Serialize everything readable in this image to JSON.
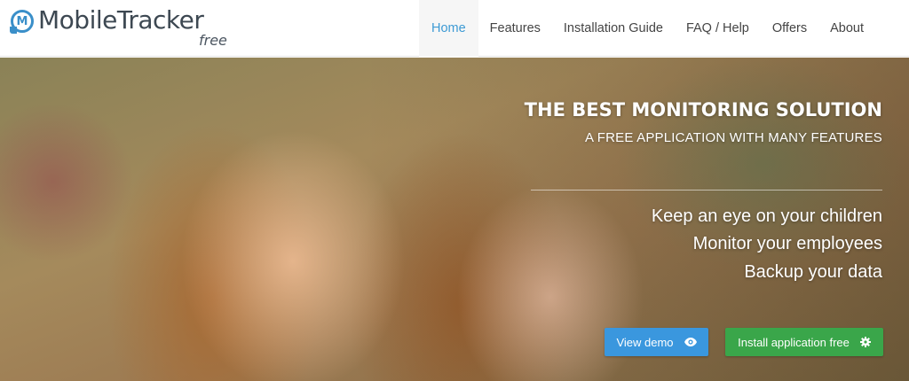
{
  "brand": {
    "name": "MobileTracker",
    "tagline": "free",
    "badge_letter": "M",
    "color": "#3a8fc9"
  },
  "nav": {
    "items": [
      {
        "label": "Home",
        "active": true
      },
      {
        "label": "Features"
      },
      {
        "label": "Installation Guide"
      },
      {
        "label": "FAQ / Help"
      },
      {
        "label": "Offers"
      },
      {
        "label": "About"
      }
    ],
    "active_color": "#3d9ad4"
  },
  "hero": {
    "title": "THE BEST MONITORING SOLUTION",
    "subtitle": "A FREE APPLICATION WITH MANY FEATURES",
    "features": [
      "Keep an eye on your children",
      "Monitor your employees",
      "Backup your data"
    ],
    "buttons": {
      "demo": {
        "label": "View demo",
        "icon": "eye-icon",
        "color": "#3a97de"
      },
      "install": {
        "label": "Install application free",
        "icon": "gear-icon",
        "color": "#3aa64a"
      }
    }
  }
}
